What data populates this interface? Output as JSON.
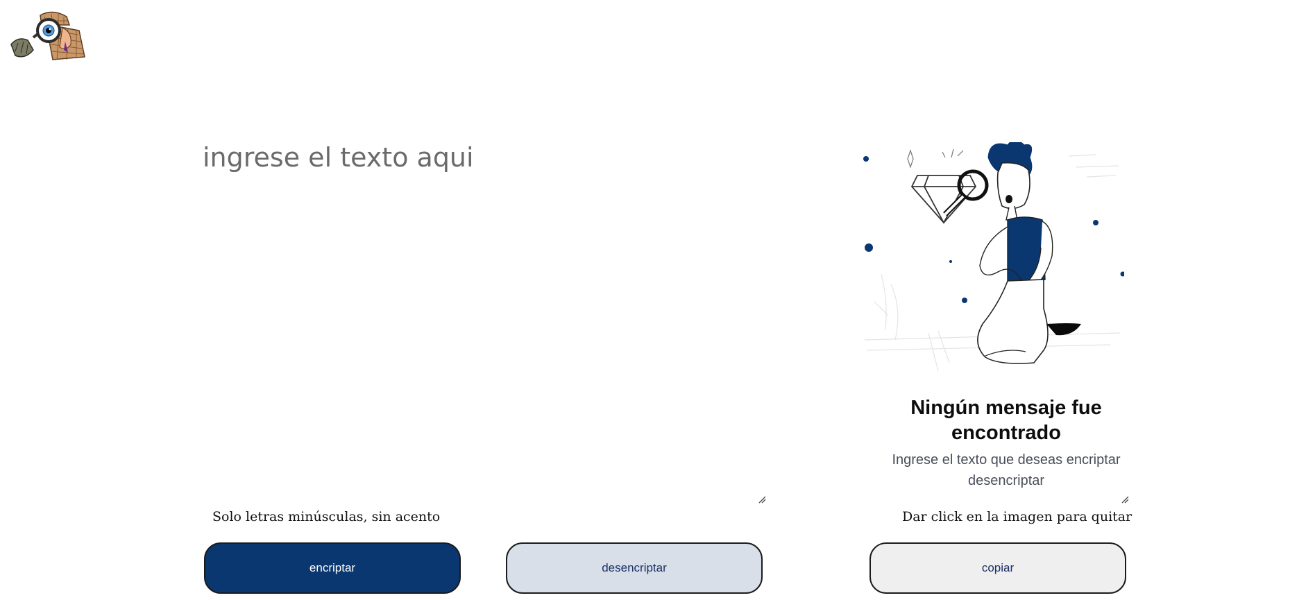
{
  "header": {
    "logo_icon": "detective-with-magnifying-glass-logo"
  },
  "input": {
    "placeholder": "ingrese el texto aqui",
    "value": "",
    "hint": "Solo letras minúsculas, sin acento"
  },
  "buttons": {
    "encrypt_label": "encriptar",
    "decrypt_label": "desencriptar",
    "copy_label": "copiar"
  },
  "output": {
    "illustration_icon": "person-inspecting-diamond-illustration",
    "title": "Ningún mensaje fue encontrado",
    "subtitle": "Ingrese el texto que deseas encriptar desencriptar",
    "hint": "Dar click en la imagen para quitar"
  },
  "colors": {
    "primary": "#0a3770",
    "secondary": "#d8dfe8",
    "copy_bg": "#efefef",
    "button_text_dark": "#1a2f66"
  }
}
